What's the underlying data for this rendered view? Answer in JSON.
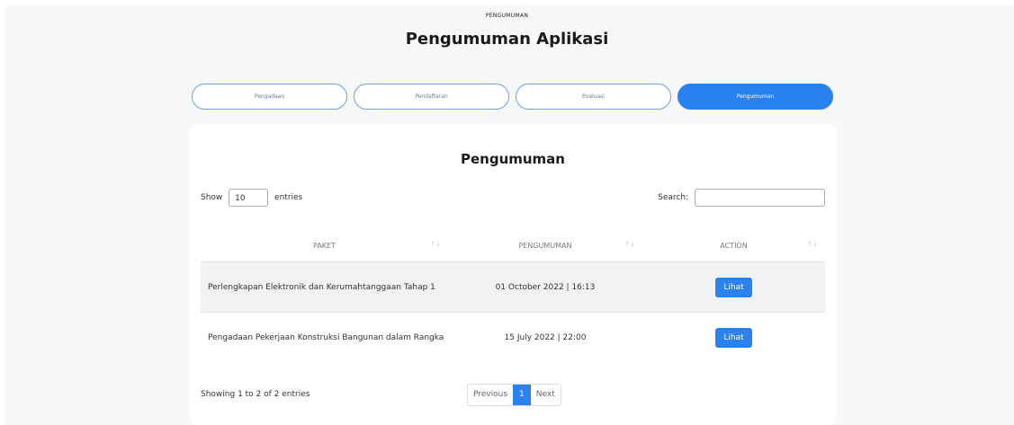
{
  "header": {
    "kicker": "PENGUMUMAN",
    "title": "Pengumuman Aplikasi"
  },
  "tabs": [
    {
      "label": "Pengadaan",
      "active": false
    },
    {
      "label": "Pendaftaran",
      "active": false
    },
    {
      "label": "Evaluasi",
      "active": false
    },
    {
      "label": "Pengumuman",
      "active": true
    }
  ],
  "card": {
    "title": "Pengumuman",
    "length": {
      "prefix": "Show",
      "value": "10",
      "suffix": "entries"
    },
    "search": {
      "label": "Search:",
      "value": ""
    },
    "table": {
      "columns": [
        "PAKET",
        "PENGUMUMAN",
        "ACTION"
      ],
      "sort_icon": "sort-arrows-icon",
      "rows": [
        {
          "paket": "Perlengkapan Elektronik dan Kerumahtanggaan Tahap 1",
          "pengumuman": "01 October 2022 | 16:13",
          "action": "Lihat"
        },
        {
          "paket": "Pengadaan Pekerjaan Konstruksi Bangunan dalam Rangka",
          "pengumuman": "15 July 2022 | 22:00",
          "action": "Lihat"
        }
      ]
    },
    "info": "Showing 1 to 2 of 2 entries",
    "pagination": {
      "previous": "Previous",
      "current": "1",
      "next": "Next"
    }
  },
  "colors": {
    "accent": "#2a82f0",
    "background": "#f7f8fa",
    "card": "#ffffff"
  }
}
